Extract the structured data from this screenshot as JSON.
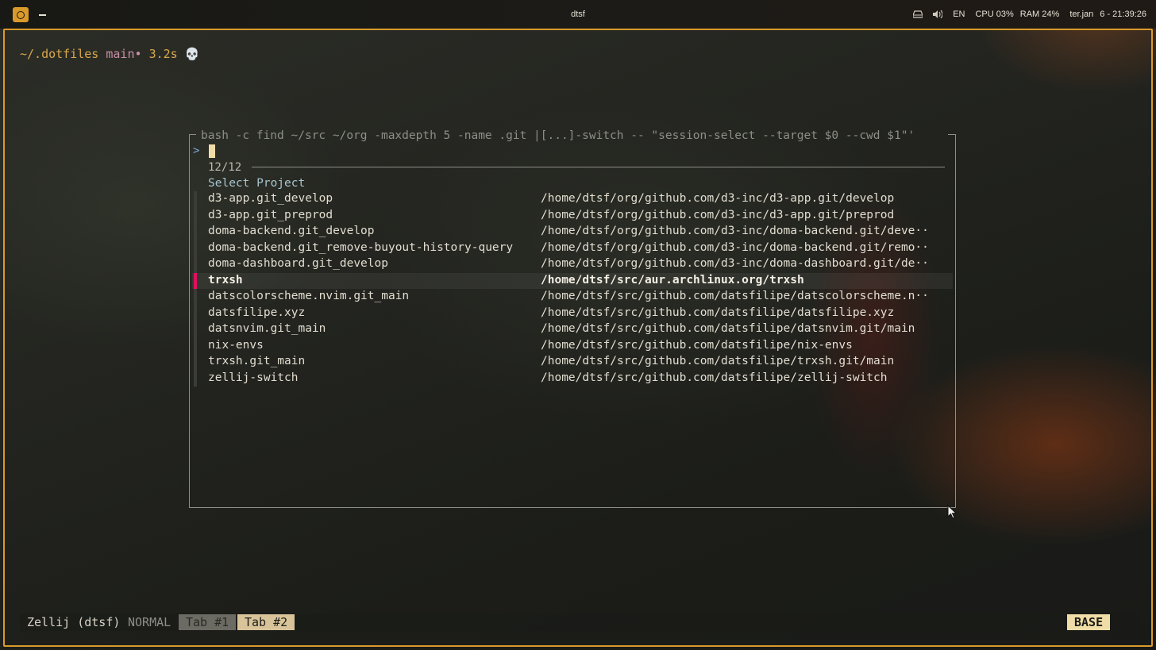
{
  "topbar": {
    "window_title": "dtsf",
    "language": "EN",
    "cpu": "CPU 03%",
    "ram": "RAM 24%",
    "date": "ter.jan",
    "time": "6 - 21:39:26"
  },
  "prompt": {
    "path": "~/.dotfiles",
    "branch": "main•",
    "duration": "3.2s",
    "icon": "💀"
  },
  "picker": {
    "header": "bash -c find ~/src ~/org -maxdepth 5 -name .git |[...]-switch -- \"session-select --target $0 --cwd $1\"'",
    "query_prompt": ">",
    "count": "12/12",
    "title": "Select Project",
    "selected_index": 5,
    "items": [
      {
        "name": "d3-app.git_develop",
        "path": "/home/dtsf/org/github.com/d3-inc/d3-app.git/develop"
      },
      {
        "name": "d3-app.git_preprod",
        "path": "/home/dtsf/org/github.com/d3-inc/d3-app.git/preprod"
      },
      {
        "name": "doma-backend.git_develop",
        "path": "/home/dtsf/org/github.com/d3-inc/doma-backend.git/deve··"
      },
      {
        "name": "doma-backend.git_remove-buyout-history-query",
        "path": "/home/dtsf/org/github.com/d3-inc/doma-backend.git/remo··"
      },
      {
        "name": "doma-dashboard.git_develop",
        "path": "/home/dtsf/org/github.com/d3-inc/doma-dashboard.git/de··"
      },
      {
        "name": "trxsh",
        "path": "/home/dtsf/src/aur.archlinux.org/trxsh"
      },
      {
        "name": "datscolorscheme.nvim.git_main",
        "path": "/home/dtsf/src/github.com/datsfilipe/datscolorscheme.n··"
      },
      {
        "name": "datsfilipe.xyz",
        "path": "/home/dtsf/src/github.com/datsfilipe/datsfilipe.xyz"
      },
      {
        "name": "datsnvim.git_main",
        "path": "/home/dtsf/src/github.com/datsfilipe/datsnvim.git/main"
      },
      {
        "name": "nix-envs",
        "path": "/home/dtsf/src/github.com/datsfilipe/nix-envs"
      },
      {
        "name": "trxsh.git_main",
        "path": "/home/dtsf/src/github.com/datsfilipe/trxsh.git/main"
      },
      {
        "name": "zellij-switch",
        "path": "/home/dtsf/src/github.com/datsfilipe/zellij-switch"
      }
    ]
  },
  "statusbar": {
    "session": "Zellij (dtsf)",
    "mode": "NORMAL",
    "tabs": [
      "Tab #1",
      "Tab #2"
    ],
    "active_tab": 1,
    "layer": "BASE"
  },
  "colors": {
    "accent": "#d99a2b",
    "selection_marker": "#e0105e",
    "path": "#d9a84c",
    "branch": "#c98fa8"
  }
}
